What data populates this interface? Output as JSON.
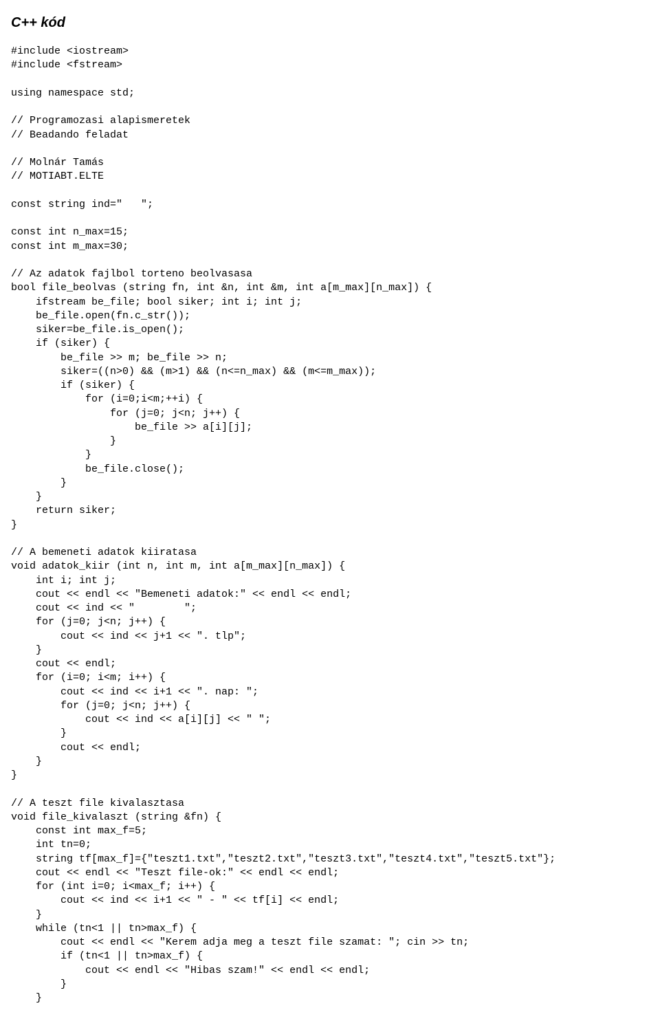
{
  "title": "C++ kód",
  "code": "#include <iostream>\n#include <fstream>\n\nusing namespace std;\n\n// Programozasi alapismeretek\n// Beadando feladat\n\n// Molnár Tamás\n// MOTIABT.ELTE\n\nconst string ind=\"   \";\n\nconst int n_max=15;\nconst int m_max=30;\n\n// Az adatok fajlbol torteno beolvasasa\nbool file_beolvas (string fn, int &n, int &m, int a[m_max][n_max]) {\n    ifstream be_file; bool siker; int i; int j;\n    be_file.open(fn.c_str());\n    siker=be_file.is_open();\n    if (siker) {\n        be_file >> m; be_file >> n;\n        siker=((n>0) && (m>1) && (n<=n_max) && (m<=m_max));\n        if (siker) {\n            for (i=0;i<m;++i) {\n                for (j=0; j<n; j++) {\n                    be_file >> a[i][j];\n                }\n            }\n            be_file.close();\n        }\n    }\n    return siker;\n}\n\n// A bemeneti adatok kiiratasa\nvoid adatok_kiir (int n, int m, int a[m_max][n_max]) {\n    int i; int j;\n    cout << endl << \"Bemeneti adatok:\" << endl << endl;\n    cout << ind << \"        \";\n    for (j=0; j<n; j++) {\n        cout << ind << j+1 << \". tlp\";\n    }\n    cout << endl;\n    for (i=0; i<m; i++) {\n        cout << ind << i+1 << \". nap: \";\n        for (j=0; j<n; j++) {\n            cout << ind << a[i][j] << \" \";\n        }\n        cout << endl;\n    }\n}\n\n// A teszt file kivalasztasa\nvoid file_kivalaszt (string &fn) {\n    const int max_f=5;\n    int tn=0;\n    string tf[max_f]={\"teszt1.txt\",\"teszt2.txt\",\"teszt3.txt\",\"teszt4.txt\",\"teszt5.txt\"};\n    cout << endl << \"Teszt file-ok:\" << endl << endl;\n    for (int i=0; i<max_f; i++) {\n        cout << ind << i+1 << \" - \" << tf[i] << endl;\n    }\n    while (tn<1 || tn>max_f) {\n        cout << endl << \"Kerem adja meg a teszt file szamat: \"; cin >> tn;\n        if (tn<1 || tn>max_f) {\n            cout << endl << \"Hibas szam!\" << endl << endl;\n        }\n    }"
}
